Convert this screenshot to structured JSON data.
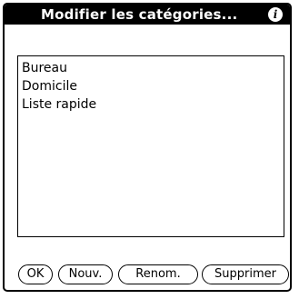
{
  "dialog": {
    "title": "Modifier les catégories...",
    "info_icon": "info-icon",
    "info_glyph": "i"
  },
  "categories": [
    "Bureau",
    "Domicile",
    "Liste rapide"
  ],
  "buttons": {
    "ok": "OK",
    "new": "Nouv.",
    "rename": "Renom.",
    "delete": "Supprimer"
  },
  "colors": {
    "title_bar": "#000000",
    "title_text": "#ffffff",
    "background": "#ffffff"
  }
}
